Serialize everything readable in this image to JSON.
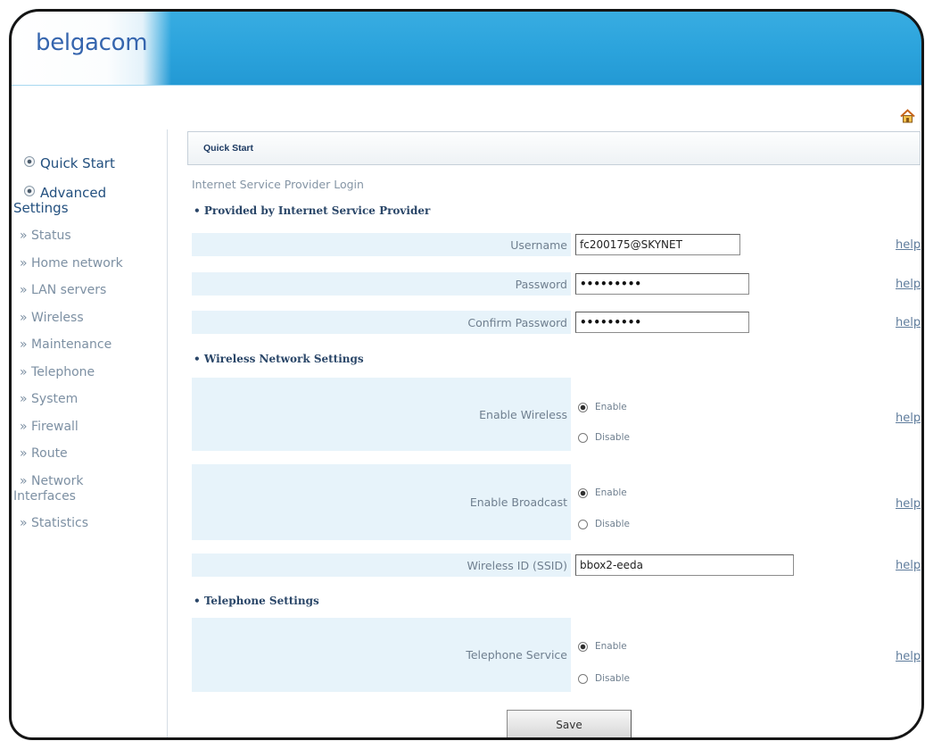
{
  "colors": {
    "header_blue": "#2ba3dc",
    "logo_blue": "#3565ae",
    "label_cell_bg": "#e7f3fa",
    "nav_main_text": "#23507f",
    "nav_sub_text": "#7d90a3",
    "section_heading": "#2a4668",
    "help_link": "#5f7c9c"
  },
  "header": {
    "logo_text": "belgacom"
  },
  "toolbar": {
    "home_icon": "home-icon"
  },
  "sidebar": {
    "main_items": [
      {
        "label": "Quick Start",
        "icon": "radio-bullet-icon"
      },
      {
        "label": "Advanced Settings",
        "icon": "radio-bullet-icon"
      }
    ],
    "sub_bullet": "»",
    "sub_items": [
      {
        "label": "Status"
      },
      {
        "label": "Home network"
      },
      {
        "label": "LAN servers"
      },
      {
        "label": "Wireless"
      },
      {
        "label": "Maintenance"
      },
      {
        "label": "Telephone"
      },
      {
        "label": "System"
      },
      {
        "label": "Firewall"
      },
      {
        "label": "Route"
      },
      {
        "label": "Network Interfaces"
      },
      {
        "label": "Statistics"
      }
    ]
  },
  "main": {
    "page_title": "Quick Start",
    "caption": "Internet Service Provider Login",
    "section_bullet": "•",
    "help_label": "help",
    "sections": [
      {
        "heading": "Provided by Internet Service Provider",
        "fields": [
          {
            "label": "Username",
            "value": "fc200175@SKYNET"
          },
          {
            "label": "Password",
            "value": "•••••••••"
          },
          {
            "label": "Confirm Password",
            "value": "•••••••••"
          }
        ]
      },
      {
        "heading": "Wireless Network Settings",
        "fields": [
          {
            "label": "Enable Wireless",
            "options": [
              "Enable",
              "Disable"
            ],
            "selected": "Enable"
          },
          {
            "label": "Enable Broadcast",
            "options": [
              "Enable",
              "Disable"
            ],
            "selected": "Enable"
          },
          {
            "label": "Wireless ID (SSID)",
            "value": "bbox2-eeda"
          }
        ]
      },
      {
        "heading": "Telephone Settings",
        "fields": [
          {
            "label": "Telephone Service",
            "options": [
              "Enable",
              "Disable"
            ],
            "selected": "Enable"
          }
        ]
      }
    ],
    "save_label": "Save"
  }
}
